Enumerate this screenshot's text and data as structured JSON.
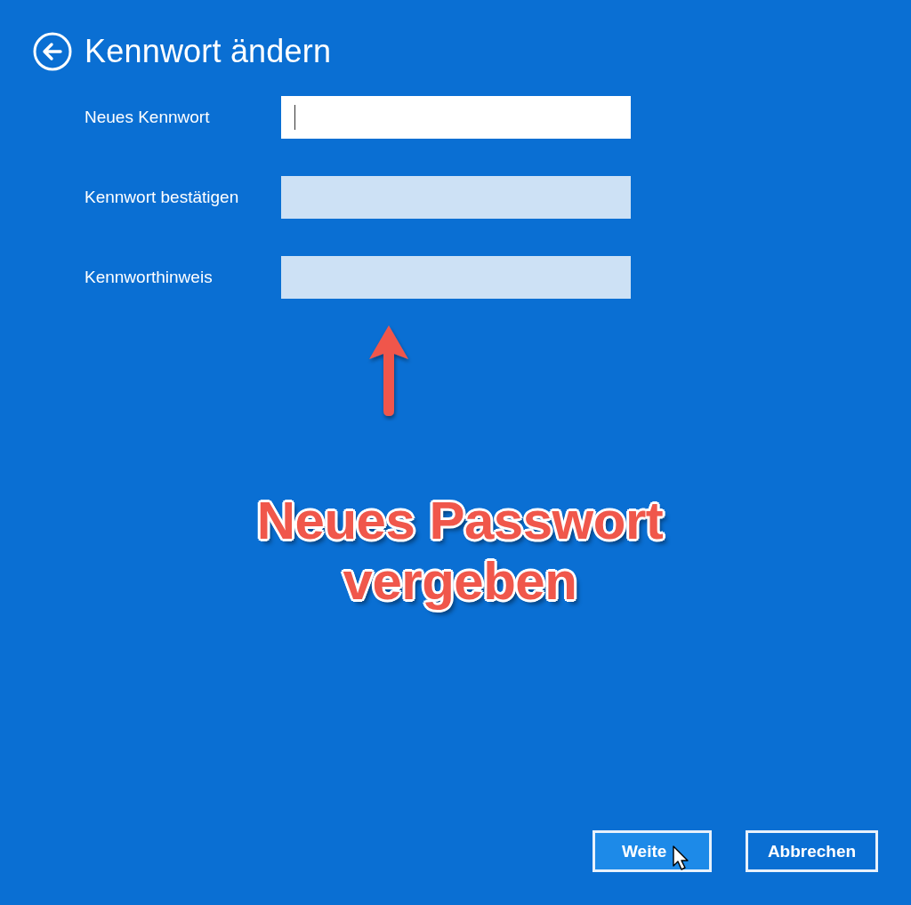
{
  "header": {
    "title": "Kennwort ändern"
  },
  "fields": [
    {
      "label": "Neues Kennwort",
      "focused": true
    },
    {
      "label": "Kennwort bestätigen",
      "focused": false
    },
    {
      "label": "Kennworthinweis",
      "focused": false
    }
  ],
  "annotation": {
    "text": "Neues Passwort vergeben"
  },
  "buttons": [
    {
      "label": "Weite",
      "hovered": true
    },
    {
      "label": "Abbrechen",
      "hovered": false
    }
  ]
}
